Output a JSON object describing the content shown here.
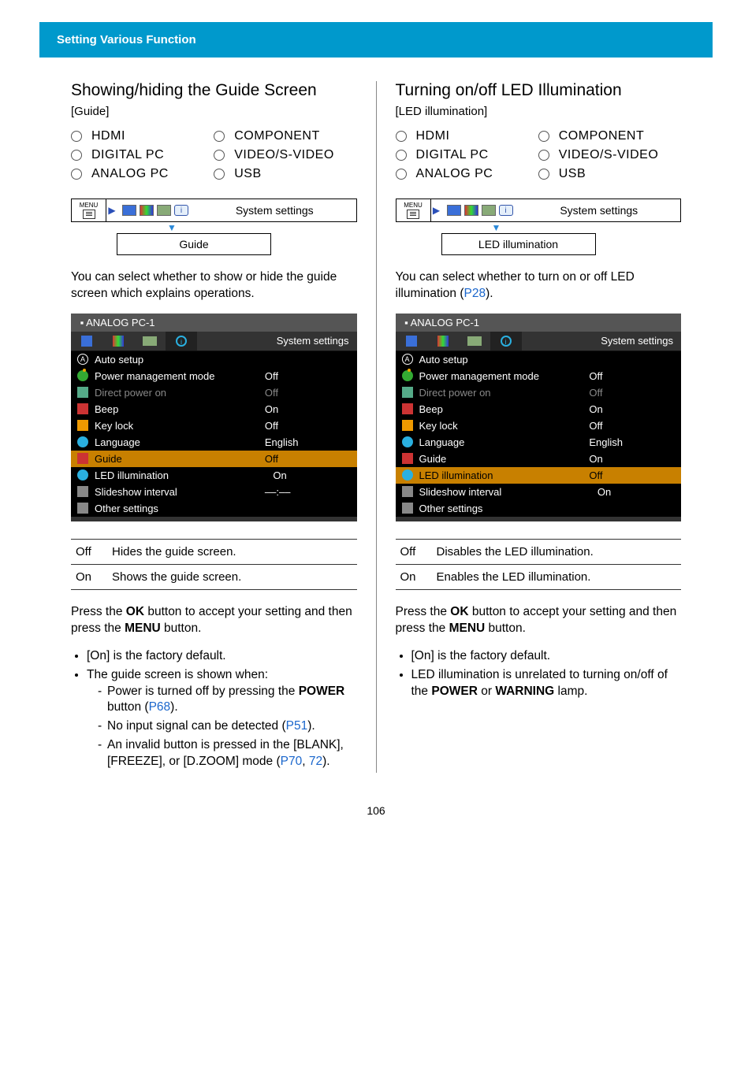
{
  "chapter": "Setting Various Function",
  "page_number": "106",
  "inputs": [
    "HDMI",
    "DIGITAL PC",
    "ANALOG PC",
    "COMPONENT",
    "VIDEO/S-VIDEO",
    "USB"
  ],
  "breadcrumb": {
    "menu": "MENU",
    "system_settings": "System settings"
  },
  "left": {
    "title": "Showing/hiding the Guide Screen",
    "bracket": "[Guide]",
    "crumb_leaf": "Guide",
    "intro": "You can select whether to show or hide the guide screen which explains operations.",
    "osd": {
      "source": "ANALOG PC-1",
      "tab_label": "System settings",
      "rows": [
        {
          "icon": "circleA",
          "label": "Auto setup",
          "val": ""
        },
        {
          "icon": "gr",
          "label": "Power management mode",
          "val": "Off"
        },
        {
          "icon": "plug",
          "label": "Direct power on",
          "val": "Off",
          "dim": true
        },
        {
          "icon": "spk",
          "label": "Beep",
          "val": "On"
        },
        {
          "icon": "lock",
          "label": "Key lock",
          "val": "Off"
        },
        {
          "icon": "globe",
          "label": "Language",
          "val": "English"
        },
        {
          "icon": "film2",
          "label": "Guide",
          "val": "Off",
          "hi": true
        },
        {
          "icon": "led",
          "label": "LED illumination",
          "val": "On",
          "tri": true
        },
        {
          "icon": "slide",
          "label": "Slideshow interval",
          "val": "––:––"
        },
        {
          "icon": "other",
          "label": "Other settings",
          "val": ""
        }
      ]
    },
    "table": [
      {
        "k": "Off",
        "v": "Hides the guide screen."
      },
      {
        "k": "On",
        "v": "Shows the guide screen."
      }
    ],
    "press_1": "Press the ",
    "press_ok": "OK",
    "press_2": " button to accept your setting and then press the ",
    "press_menu": "MENU",
    "press_3": " button.",
    "b1": "[On] is the factory default.",
    "b2": "The guide screen is shown when:",
    "s1a": "Power is turned off by pressing the ",
    "s1b": "POWER",
    "s1c": " button (",
    "s1link": "P68",
    "s1d": ").",
    "s2a": "No input signal can be detected (",
    "s2link": "P51",
    "s2b": ").",
    "s3a": "An invalid button is pressed in the [BLANK], [FREEZE], or [D.ZOOM] mode (",
    "s3link1": "P70",
    "s3sep": ", ",
    "s3link2": "72",
    "s3b": ")."
  },
  "right": {
    "title": "Turning on/off LED Illumination",
    "bracket": "[LED illumination]",
    "crumb_leaf": "LED illumination",
    "intro_a": "You can select whether to turn on or off LED illumination (",
    "intro_link": "P28",
    "intro_b": ").",
    "osd": {
      "source": "ANALOG PC-1",
      "tab_label": "System settings",
      "rows": [
        {
          "icon": "circleA",
          "label": "Auto setup",
          "val": ""
        },
        {
          "icon": "gr",
          "label": "Power management mode",
          "val": "Off"
        },
        {
          "icon": "plug",
          "label": "Direct power on",
          "val": "Off",
          "dim": true
        },
        {
          "icon": "spk",
          "label": "Beep",
          "val": "On"
        },
        {
          "icon": "lock",
          "label": "Key lock",
          "val": "Off"
        },
        {
          "icon": "globe",
          "label": "Language",
          "val": "English"
        },
        {
          "icon": "film2",
          "label": "Guide",
          "val": "On"
        },
        {
          "icon": "led",
          "label": "LED illumination",
          "val": "Off",
          "hi": true
        },
        {
          "icon": "slide",
          "label": "Slideshow interval",
          "val": "On",
          "tri": true
        },
        {
          "icon": "other",
          "label": "Other settings",
          "val": ""
        }
      ]
    },
    "table": [
      {
        "k": "Off",
        "v": "Disables the LED illumination."
      },
      {
        "k": "On",
        "v": "Enables the LED illumination."
      }
    ],
    "press_1": "Press the ",
    "press_ok": "OK",
    "press_2": " button to accept your setting and then press the ",
    "press_menu": "MENU",
    "press_3": " button.",
    "b1": "[On] is the factory default.",
    "b2a": "LED illumination is unrelated to turning on/off of the ",
    "b2b": "POWER",
    "b2c": " or ",
    "b2d": "WARNING",
    "b2e": " lamp."
  }
}
